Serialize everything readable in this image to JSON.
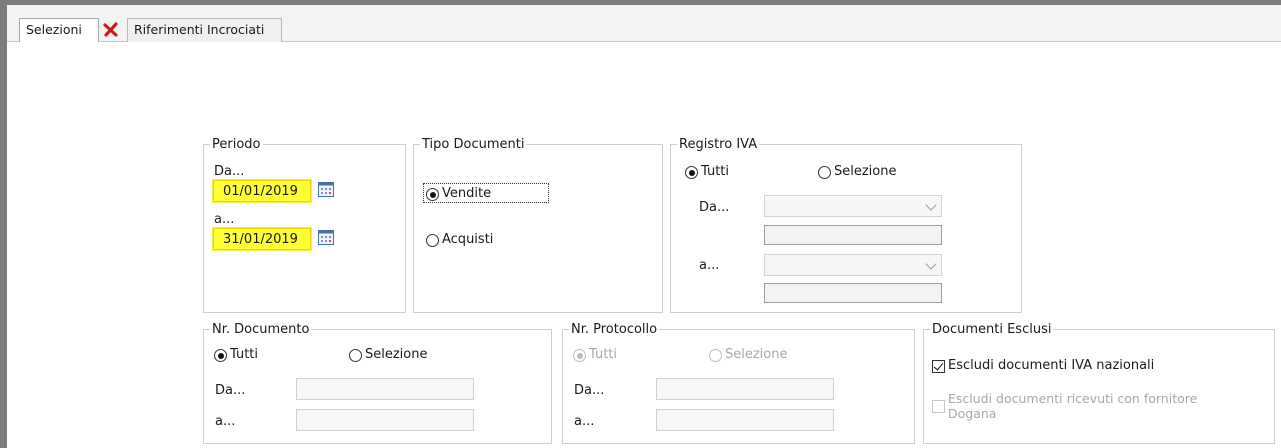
{
  "tabs": {
    "active_label": "Selezioni",
    "inactive_label": "Riferimenti Incrociati"
  },
  "periodo": {
    "legend": "Periodo",
    "from_label": "Da...",
    "from_value": "01/01/2019",
    "to_label": "a...",
    "to_value": "31/01/2019"
  },
  "tipo_documenti": {
    "legend": "Tipo Documenti",
    "option_vendite": "Vendite",
    "option_acquisti": "Acquisti",
    "selected": "Vendite"
  },
  "registro_iva": {
    "legend": "Registro IVA",
    "option_tutti": "Tutti",
    "option_selezione": "Selezione",
    "selected": "Tutti",
    "from_label": "Da...",
    "to_label": "a..."
  },
  "nr_documento": {
    "legend": "Nr. Documento",
    "option_tutti": "Tutti",
    "option_selezione": "Selezione",
    "selected": "Tutti",
    "from_label": "Da...",
    "to_label": "a..."
  },
  "nr_protocollo": {
    "legend": "Nr. Protocollo",
    "option_tutti": "Tutti",
    "option_selezione": "Selezione",
    "selected": "Tutti",
    "from_label": "Da...",
    "to_label": "a..."
  },
  "documenti_esclusi": {
    "legend": "Documenti Esclusi",
    "check_iva_nazionali": "Escludi documenti IVA nazionali",
    "check_iva_nazionali_checked": true,
    "check_dogana_line1": "Escludi documenti ricevuti con fornitore",
    "check_dogana_line2": "Dogana",
    "check_dogana_checked": false
  },
  "colors": {
    "date_highlight": "#ffff33",
    "close_icon": "#d42020"
  }
}
